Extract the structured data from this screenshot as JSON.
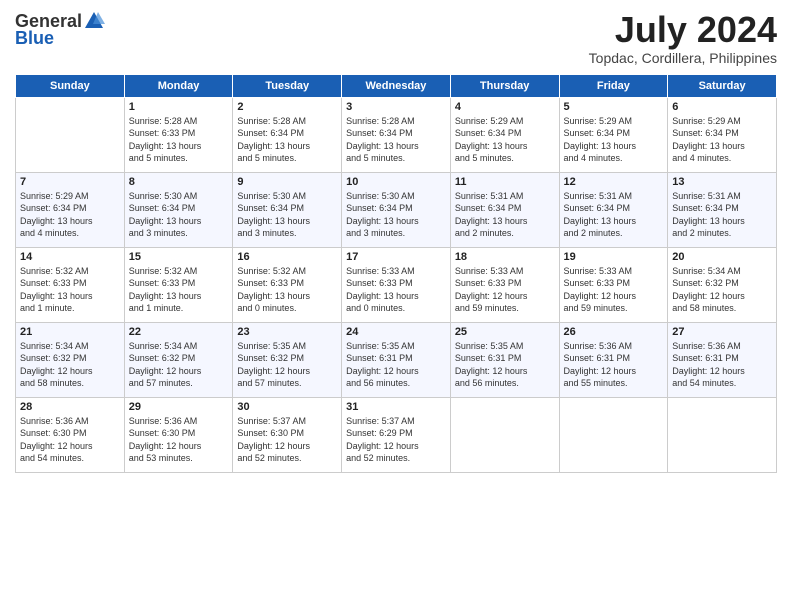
{
  "header": {
    "logo_general": "General",
    "logo_blue": "Blue",
    "title": "July 2024",
    "location": "Topdac, Cordillera, Philippines"
  },
  "weekdays": [
    "Sunday",
    "Monday",
    "Tuesday",
    "Wednesday",
    "Thursday",
    "Friday",
    "Saturday"
  ],
  "weeks": [
    [
      {
        "day": "",
        "sunrise": "",
        "sunset": "",
        "daylight": ""
      },
      {
        "day": "1",
        "sunrise": "Sunrise: 5:28 AM",
        "sunset": "Sunset: 6:33 PM",
        "daylight": "Daylight: 13 hours and 5 minutes."
      },
      {
        "day": "2",
        "sunrise": "Sunrise: 5:28 AM",
        "sunset": "Sunset: 6:34 PM",
        "daylight": "Daylight: 13 hours and 5 minutes."
      },
      {
        "day": "3",
        "sunrise": "Sunrise: 5:28 AM",
        "sunset": "Sunset: 6:34 PM",
        "daylight": "Daylight: 13 hours and 5 minutes."
      },
      {
        "day": "4",
        "sunrise": "Sunrise: 5:29 AM",
        "sunset": "Sunset: 6:34 PM",
        "daylight": "Daylight: 13 hours and 5 minutes."
      },
      {
        "day": "5",
        "sunrise": "Sunrise: 5:29 AM",
        "sunset": "Sunset: 6:34 PM",
        "daylight": "Daylight: 13 hours and 4 minutes."
      },
      {
        "day": "6",
        "sunrise": "Sunrise: 5:29 AM",
        "sunset": "Sunset: 6:34 PM",
        "daylight": "Daylight: 13 hours and 4 minutes."
      }
    ],
    [
      {
        "day": "7",
        "sunrise": "Sunrise: 5:29 AM",
        "sunset": "Sunset: 6:34 PM",
        "daylight": "Daylight: 13 hours and 4 minutes."
      },
      {
        "day": "8",
        "sunrise": "Sunrise: 5:30 AM",
        "sunset": "Sunset: 6:34 PM",
        "daylight": "Daylight: 13 hours and 3 minutes."
      },
      {
        "day": "9",
        "sunrise": "Sunrise: 5:30 AM",
        "sunset": "Sunset: 6:34 PM",
        "daylight": "Daylight: 13 hours and 3 minutes."
      },
      {
        "day": "10",
        "sunrise": "Sunrise: 5:30 AM",
        "sunset": "Sunset: 6:34 PM",
        "daylight": "Daylight: 13 hours and 3 minutes."
      },
      {
        "day": "11",
        "sunrise": "Sunrise: 5:31 AM",
        "sunset": "Sunset: 6:34 PM",
        "daylight": "Daylight: 13 hours and 2 minutes."
      },
      {
        "day": "12",
        "sunrise": "Sunrise: 5:31 AM",
        "sunset": "Sunset: 6:34 PM",
        "daylight": "Daylight: 13 hours and 2 minutes."
      },
      {
        "day": "13",
        "sunrise": "Sunrise: 5:31 AM",
        "sunset": "Sunset: 6:34 PM",
        "daylight": "Daylight: 13 hours and 2 minutes."
      }
    ],
    [
      {
        "day": "14",
        "sunrise": "Sunrise: 5:32 AM",
        "sunset": "Sunset: 6:33 PM",
        "daylight": "Daylight: 13 hours and 1 minute."
      },
      {
        "day": "15",
        "sunrise": "Sunrise: 5:32 AM",
        "sunset": "Sunset: 6:33 PM",
        "daylight": "Daylight: 13 hours and 1 minute."
      },
      {
        "day": "16",
        "sunrise": "Sunrise: 5:32 AM",
        "sunset": "Sunset: 6:33 PM",
        "daylight": "Daylight: 13 hours and 0 minutes."
      },
      {
        "day": "17",
        "sunrise": "Sunrise: 5:33 AM",
        "sunset": "Sunset: 6:33 PM",
        "daylight": "Daylight: 13 hours and 0 minutes."
      },
      {
        "day": "18",
        "sunrise": "Sunrise: 5:33 AM",
        "sunset": "Sunset: 6:33 PM",
        "daylight": "Daylight: 12 hours and 59 minutes."
      },
      {
        "day": "19",
        "sunrise": "Sunrise: 5:33 AM",
        "sunset": "Sunset: 6:33 PM",
        "daylight": "Daylight: 12 hours and 59 minutes."
      },
      {
        "day": "20",
        "sunrise": "Sunrise: 5:34 AM",
        "sunset": "Sunset: 6:32 PM",
        "daylight": "Daylight: 12 hours and 58 minutes."
      }
    ],
    [
      {
        "day": "21",
        "sunrise": "Sunrise: 5:34 AM",
        "sunset": "Sunset: 6:32 PM",
        "daylight": "Daylight: 12 hours and 58 minutes."
      },
      {
        "day": "22",
        "sunrise": "Sunrise: 5:34 AM",
        "sunset": "Sunset: 6:32 PM",
        "daylight": "Daylight: 12 hours and 57 minutes."
      },
      {
        "day": "23",
        "sunrise": "Sunrise: 5:35 AM",
        "sunset": "Sunset: 6:32 PM",
        "daylight": "Daylight: 12 hours and 57 minutes."
      },
      {
        "day": "24",
        "sunrise": "Sunrise: 5:35 AM",
        "sunset": "Sunset: 6:31 PM",
        "daylight": "Daylight: 12 hours and 56 minutes."
      },
      {
        "day": "25",
        "sunrise": "Sunrise: 5:35 AM",
        "sunset": "Sunset: 6:31 PM",
        "daylight": "Daylight: 12 hours and 56 minutes."
      },
      {
        "day": "26",
        "sunrise": "Sunrise: 5:36 AM",
        "sunset": "Sunset: 6:31 PM",
        "daylight": "Daylight: 12 hours and 55 minutes."
      },
      {
        "day": "27",
        "sunrise": "Sunrise: 5:36 AM",
        "sunset": "Sunset: 6:31 PM",
        "daylight": "Daylight: 12 hours and 54 minutes."
      }
    ],
    [
      {
        "day": "28",
        "sunrise": "Sunrise: 5:36 AM",
        "sunset": "Sunset: 6:30 PM",
        "daylight": "Daylight: 12 hours and 54 minutes."
      },
      {
        "day": "29",
        "sunrise": "Sunrise: 5:36 AM",
        "sunset": "Sunset: 6:30 PM",
        "daylight": "Daylight: 12 hours and 53 minutes."
      },
      {
        "day": "30",
        "sunrise": "Sunrise: 5:37 AM",
        "sunset": "Sunset: 6:30 PM",
        "daylight": "Daylight: 12 hours and 52 minutes."
      },
      {
        "day": "31",
        "sunrise": "Sunrise: 5:37 AM",
        "sunset": "Sunset: 6:29 PM",
        "daylight": "Daylight: 12 hours and 52 minutes."
      },
      {
        "day": "",
        "sunrise": "",
        "sunset": "",
        "daylight": ""
      },
      {
        "day": "",
        "sunrise": "",
        "sunset": "",
        "daylight": ""
      },
      {
        "day": "",
        "sunrise": "",
        "sunset": "",
        "daylight": ""
      }
    ]
  ]
}
